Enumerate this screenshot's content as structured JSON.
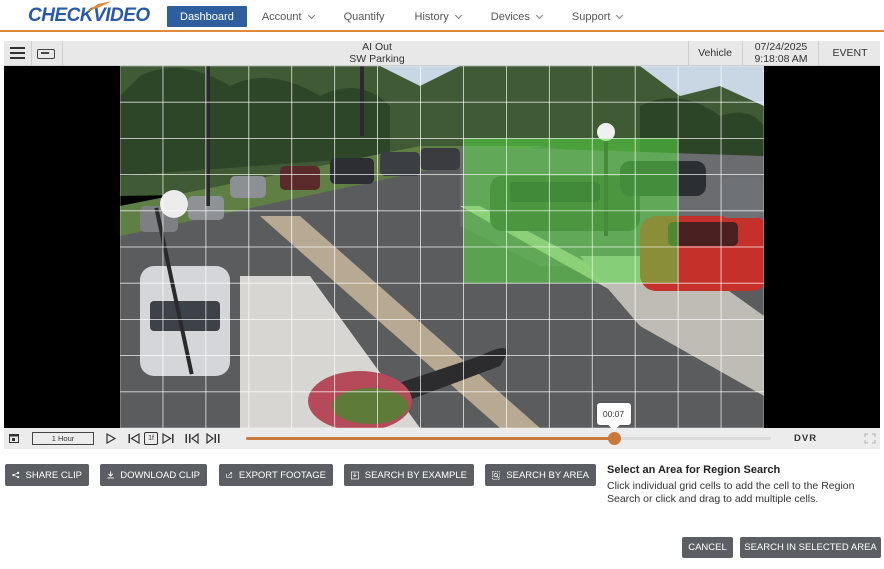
{
  "brand": {
    "logo_part1": "CHECK",
    "logo_part2": "VIDEO"
  },
  "nav": {
    "items": [
      {
        "label": "Dashboard",
        "active": true
      },
      {
        "label": "Account",
        "dropdown": true
      },
      {
        "label": "Quantify",
        "dropdown": false
      },
      {
        "label": "History",
        "dropdown": true
      },
      {
        "label": "Devices",
        "dropdown": true
      },
      {
        "label": "Support",
        "dropdown": true
      }
    ]
  },
  "video_header": {
    "camera_name": "AI Out",
    "camera_location": "SW Parking",
    "detection_type": "Vehicle",
    "date": "07/24/2025",
    "time": "9:18:08 AM",
    "event_label": "EVENT"
  },
  "player": {
    "range_label": "1 Hour",
    "speed_label": "1f",
    "position_fraction": 0.7,
    "position_time": "00:07",
    "mode_label": "DVR"
  },
  "region": {
    "title": "Select an Area for Region Search",
    "description": "Click individual grid cells to add the cell to the Region Search or click and drag to add multiple cells."
  },
  "actions": {
    "share": "SHARE CLIP",
    "download": "DOWNLOAD CLIP",
    "export": "EXPORT FOOTAGE",
    "search_example": "SEARCH BY EXAMPLE",
    "search_area": "SEARCH BY AREA",
    "cancel": "CANCEL",
    "search_selected": "SEARCH IN SELECTED AREA"
  },
  "colors": {
    "brand_blue": "#2f5e9e",
    "accent_orange": "#c9793c",
    "selection_green": "#5adc46"
  },
  "grid": {
    "columns": 15,
    "rows": 10,
    "selected_cells": [
      [
        8,
        2
      ],
      [
        9,
        2
      ],
      [
        10,
        2
      ],
      [
        11,
        2
      ],
      [
        12,
        2
      ],
      [
        8,
        3
      ],
      [
        9,
        3
      ],
      [
        10,
        3
      ],
      [
        11,
        3
      ],
      [
        12,
        3
      ],
      [
        8,
        4
      ],
      [
        9,
        4
      ],
      [
        10,
        4
      ],
      [
        11,
        4
      ],
      [
        12,
        4
      ],
      [
        8,
        5
      ],
      [
        9,
        5
      ],
      [
        10,
        5
      ],
      [
        11,
        5
      ],
      [
        12,
        5
      ]
    ]
  }
}
